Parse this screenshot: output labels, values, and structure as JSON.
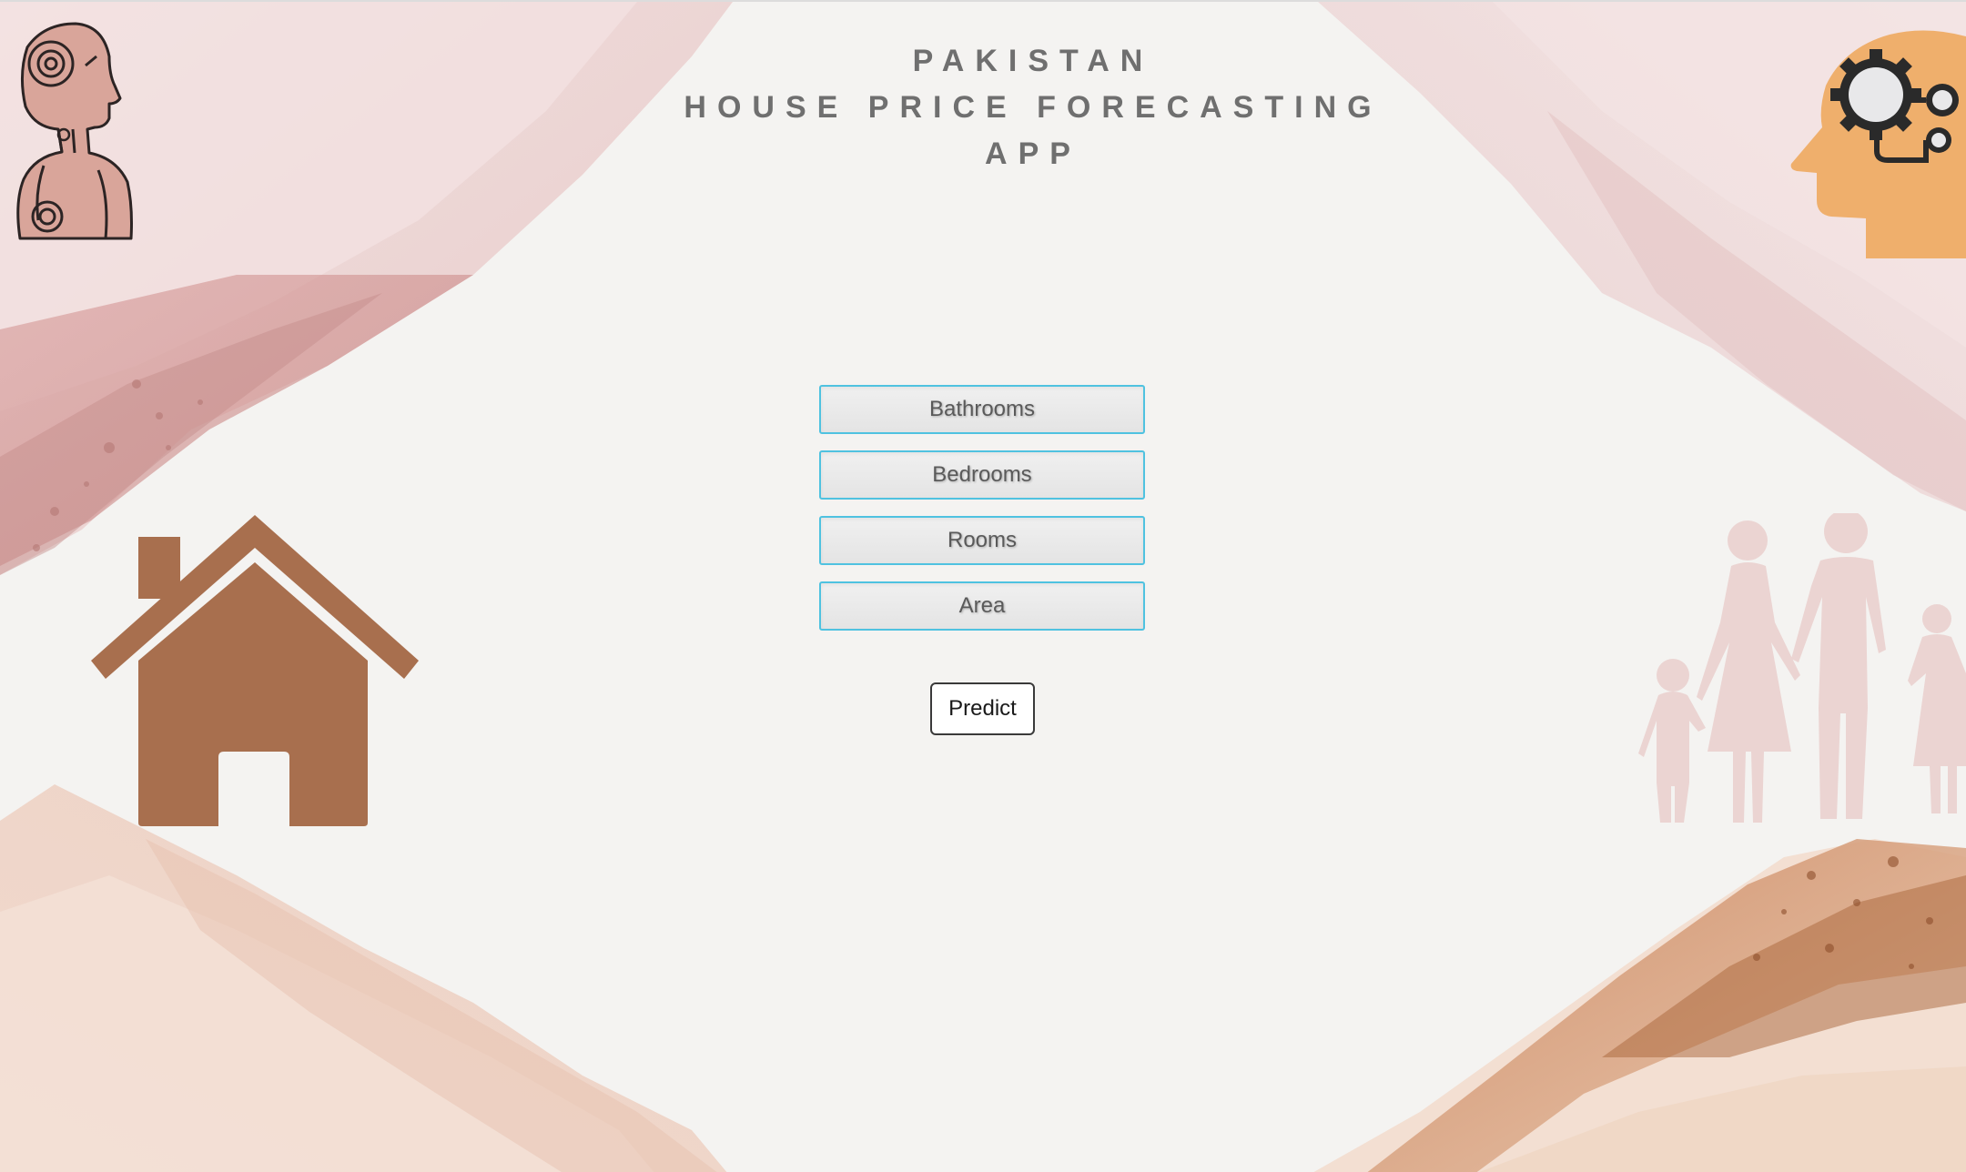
{
  "header": {
    "title_line1": "PAKISTAN",
    "title_line2": "HOUSE PRICE FORECASTING",
    "title_line3": "APP"
  },
  "form": {
    "bathrooms_placeholder": "Bathrooms",
    "bedrooms_placeholder": "Bedrooms",
    "rooms_placeholder": "Rooms",
    "area_placeholder": "Area",
    "predict_label": "Predict"
  },
  "decorations": {
    "top_left_icon": "robot-icon",
    "top_right_icon": "head-gears-icon",
    "left_icon": "house-icon",
    "right_icon": "family-icon"
  },
  "colors": {
    "background": "#f4f3f1",
    "title": "#6f6f6f",
    "field_border": "#4fc2e0",
    "house": "#a86f4e",
    "head": "#efaf6c",
    "family": "#ebd4d2"
  }
}
